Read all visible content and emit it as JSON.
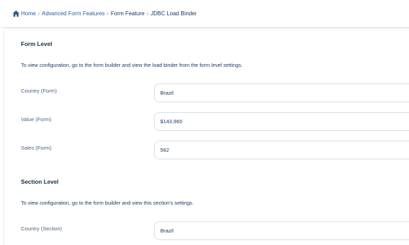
{
  "breadcrumb": {
    "items": [
      "Home",
      "Advanced Form Features",
      "Form Feature",
      "JDBC Load Binder"
    ],
    "separator": "›"
  },
  "form_level": {
    "title": "Form Level",
    "description": "To view configuration, go to the form builder and view the load binder from the form level settings.",
    "fields": [
      {
        "label": "Country (Form)",
        "value": "Brazil"
      },
      {
        "label": "Value (Form)",
        "value": "$143,960"
      },
      {
        "label": "Sales (Form)",
        "value": "562"
      }
    ]
  },
  "section_level": {
    "title": "Section Level",
    "description": "To view configuration, go to the form builder and view this section's settings.",
    "fields": [
      {
        "label": "Country (Section)",
        "value": "Brazil"
      }
    ]
  },
  "colors": {
    "primary_text": "#0f2d4f",
    "link": "#2e5d8f",
    "border": "#d9dee4"
  }
}
